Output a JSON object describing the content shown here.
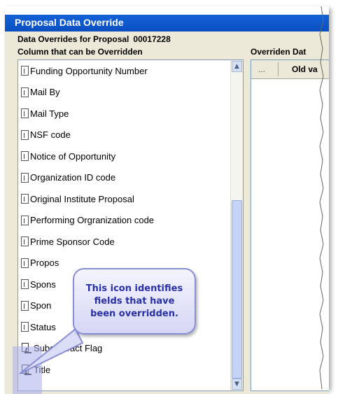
{
  "window": {
    "title": "Proposal Data Override",
    "subtitle": "Data Overrides for Proposal",
    "proposal_number": "00017228"
  },
  "left_panel": {
    "header": "Column that can be Overridden",
    "items": [
      {
        "label": "Funding Opportunity Number",
        "overridden": false
      },
      {
        "label": "Mail By",
        "overridden": false
      },
      {
        "label": "Mail Type",
        "overridden": false
      },
      {
        "label": "NSF code",
        "overridden": false
      },
      {
        "label": "Notice of Opportunity",
        "overridden": false
      },
      {
        "label": "Organization ID code",
        "overridden": false
      },
      {
        "label": "Original Institute Proposal",
        "overridden": false
      },
      {
        "label": "Performing Orgranization code",
        "overridden": false
      },
      {
        "label": "Prime Sponsor Code",
        "overridden": false
      },
      {
        "label": "Propos",
        "overridden": false
      },
      {
        "label": "Spons",
        "overridden": false
      },
      {
        "label": "Spon",
        "overridden": false
      },
      {
        "label": "Status",
        "overridden": false
      },
      {
        "label": "Subcontract Flag",
        "overridden": true
      },
      {
        "label": "Title",
        "overridden": true
      }
    ]
  },
  "right_panel": {
    "header": "Overriden Dat",
    "columns": [
      "...",
      "Old va"
    ]
  },
  "callout": {
    "text": "This icon identifies fields that have been overridden."
  },
  "icons": {
    "normal": "document-icon",
    "overridden": "override-icon"
  }
}
